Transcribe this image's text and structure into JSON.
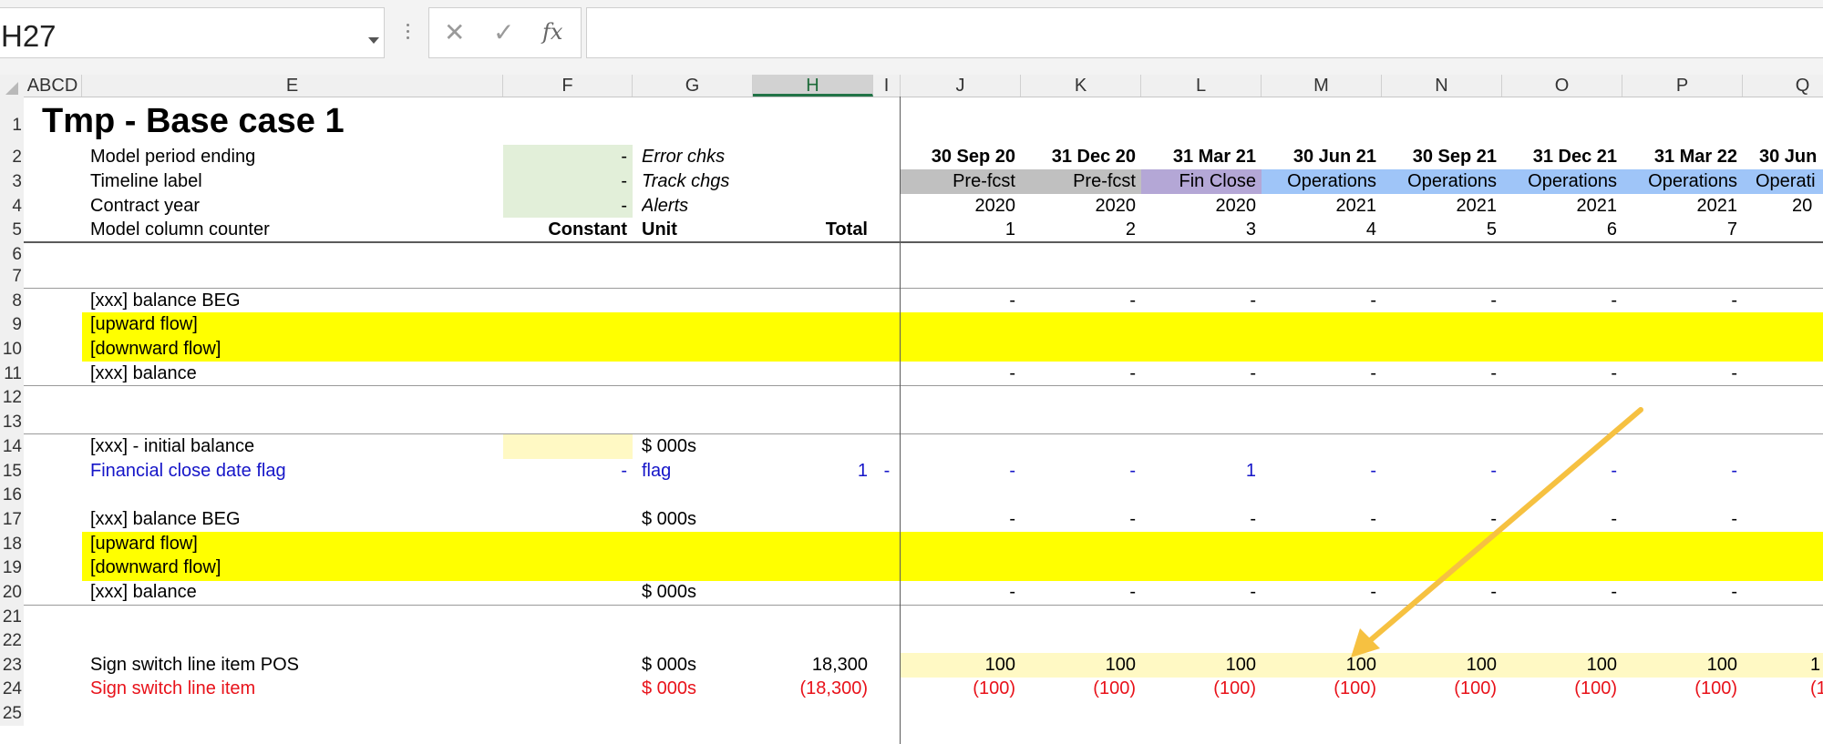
{
  "name_box": {
    "value": "H27"
  },
  "formula_bar": {
    "cancel_symbol": "✕",
    "enter_symbol": "✓",
    "fx_label": "fx",
    "value": ""
  },
  "columns": [
    "ABCD",
    "E",
    "F",
    "G",
    "H",
    "I",
    "J",
    "K",
    "L",
    "M",
    "N",
    "O",
    "P",
    "Q"
  ],
  "rows": [
    "1",
    "2",
    "3",
    "4",
    "5",
    "6",
    "7",
    "8",
    "9",
    "10",
    "11",
    "12",
    "13",
    "14",
    "15",
    "16",
    "17",
    "18",
    "19",
    "20",
    "21",
    "22",
    "23",
    "24",
    "25"
  ],
  "sheet": {
    "title": "Tmp - Base case 1",
    "row2": {
      "label": "Model period ending",
      "f": "-",
      "g": "Error chks"
    },
    "row3": {
      "label": "Timeline label",
      "f": "-",
      "g": "Track chgs"
    },
    "row4": {
      "label": "Contract year",
      "f": "-",
      "g": "Alerts"
    },
    "row5": {
      "label": "Model column counter",
      "f": "Constant",
      "g": "Unit",
      "h": "Total"
    },
    "periods": [
      "30 Sep 20",
      "31 Dec 20",
      "31 Mar 21",
      "30 Jun 21",
      "30 Sep 21",
      "31 Dec 21",
      "31 Mar 22",
      "30 Jun"
    ],
    "timeline": [
      "Pre-fcst",
      "Pre-fcst",
      "Fin Close",
      "Operations",
      "Operations",
      "Operations",
      "Operations",
      "Operati"
    ],
    "years": [
      "2020",
      "2020",
      "2020",
      "2021",
      "2021",
      "2021",
      "2021",
      "20"
    ],
    "counters": [
      "1",
      "2",
      "3",
      "4",
      "5",
      "6",
      "7",
      ""
    ],
    "row8": {
      "label": "[xxx] balance BEG",
      "values": [
        "-",
        "-",
        "-",
        "-",
        "-",
        "-",
        "-"
      ]
    },
    "row9": {
      "label": "[upward flow]"
    },
    "row10": {
      "label": "[downward flow]"
    },
    "row11": {
      "label": "[xxx] balance",
      "values": [
        "-",
        "-",
        "-",
        "-",
        "-",
        "-",
        "-"
      ]
    },
    "row14": {
      "label": "[xxx] - initial balance",
      "g": "$ 000s"
    },
    "row15": {
      "label": "Financial close date flag",
      "f": "-",
      "g": "flag",
      "h": "1",
      "i": "-",
      "values": [
        "-",
        "-",
        "1",
        "-",
        "-",
        "-",
        "-"
      ]
    },
    "row17": {
      "label": "[xxx] balance BEG",
      "g": "$ 000s",
      "values": [
        "-",
        "-",
        "-",
        "-",
        "-",
        "-",
        "-"
      ]
    },
    "row18": {
      "label": "[upward flow]"
    },
    "row19": {
      "label": "[downward flow]"
    },
    "row20": {
      "label": "[xxx] balance",
      "g": "$ 000s",
      "values": [
        "-",
        "-",
        "-",
        "-",
        "-",
        "-",
        "-"
      ]
    },
    "row23": {
      "label": "Sign switch line item POS",
      "g": "$ 000s",
      "h": "18,300",
      "values": [
        "100",
        "100",
        "100",
        "100",
        "100",
        "100",
        "100",
        "1"
      ]
    },
    "row24": {
      "label": "Sign switch line item",
      "g": "$ 000s",
      "h": "(18,300)",
      "values": [
        "(100)",
        "(100)",
        "(100)",
        "(100)",
        "(100)",
        "(100)",
        "(100)",
        "(1"
      ]
    }
  },
  "colors": {
    "green_input": "#e2efd9",
    "gray_prefcst": "#c0c0c0",
    "purple_finclose": "#b4a7d6",
    "blue_operations": "#9fc5f8",
    "yellow_flow": "#ffff00",
    "light_yellow": "#fff9c4",
    "arrow": "#f6c141"
  }
}
